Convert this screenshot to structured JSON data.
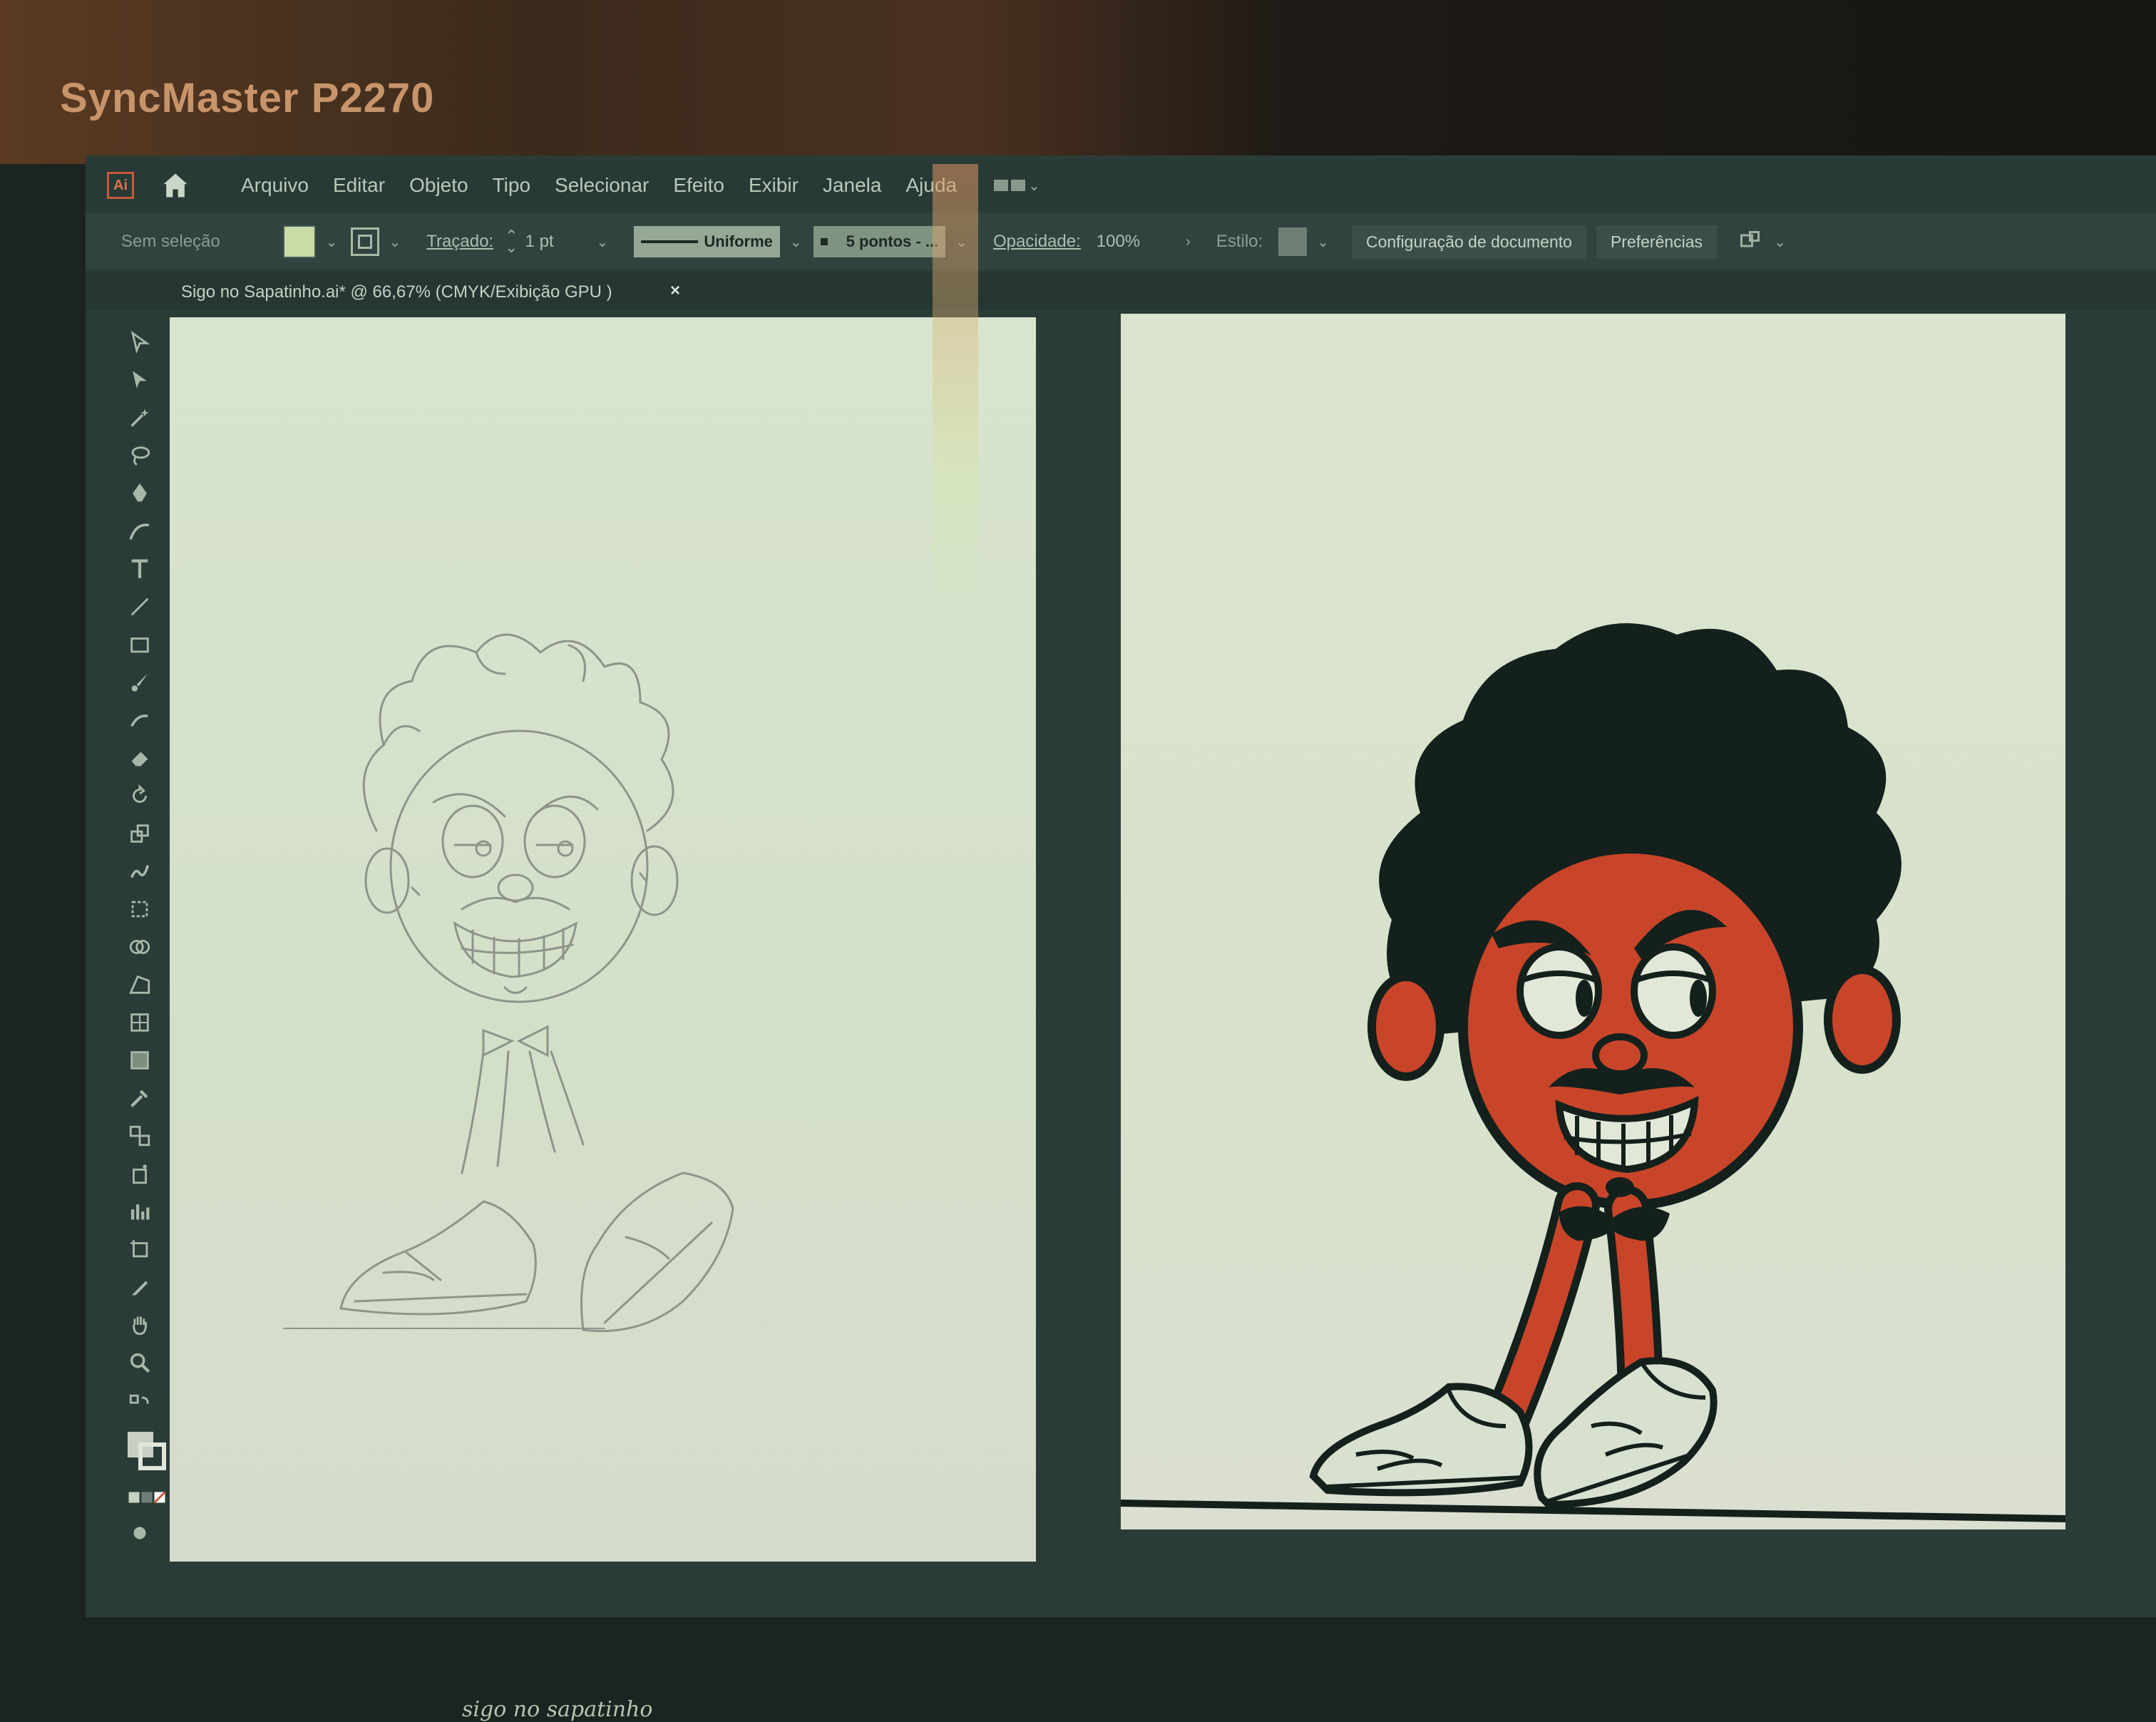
{
  "monitor": {
    "brand": "SyncMaster P2270"
  },
  "app": {
    "logo": "Ai"
  },
  "menu": {
    "items": [
      "Arquivo",
      "Editar",
      "Objeto",
      "Tipo",
      "Selecionar",
      "Efeito",
      "Exibir",
      "Janela",
      "Ajuda"
    ]
  },
  "control_bar": {
    "selection_status": "Sem seleção",
    "stroke_label": "Traçado:",
    "stroke_weight": "1 pt",
    "profile": "Uniforme",
    "brush": "5 pontos - ...",
    "opacity_label": "Opacidade:",
    "opacity_value": "100%",
    "style_label": "Estilo:",
    "doc_setup_button": "Configuração de documento",
    "preferences_button": "Preferências",
    "fill_color": "#c9dba6"
  },
  "document_tab": {
    "title": "Sigo no Sapatinho.ai* @ 66,67% (CMYK/Exibição GPU )",
    "close": "×"
  },
  "tools": [
    "selection-tool-icon",
    "direct-selection-tool-icon",
    "magic-wand-icon",
    "lasso-icon",
    "pen-icon",
    "curvature-icon",
    "type-icon",
    "line-icon",
    "rectangle-icon",
    "paintbrush-icon",
    "shaper-icon",
    "eraser-icon",
    "rotate-icon",
    "scale-icon",
    "warp-icon",
    "free-transform-icon",
    "shape-builder-icon",
    "perspective-icon",
    "mesh-icon",
    "gradient-icon",
    "eyedropper-icon",
    "blend-icon",
    "symbol-sprayer-icon",
    "graph-icon",
    "artboard-icon",
    "slice-icon",
    "hand-icon",
    "zoom-icon"
  ],
  "colors": {
    "character_skin": "#c8452a",
    "hair": "#14201c",
    "ui_bg": "#2a3c38"
  },
  "sketch": {
    "caption": "sigo no sapatinho"
  }
}
